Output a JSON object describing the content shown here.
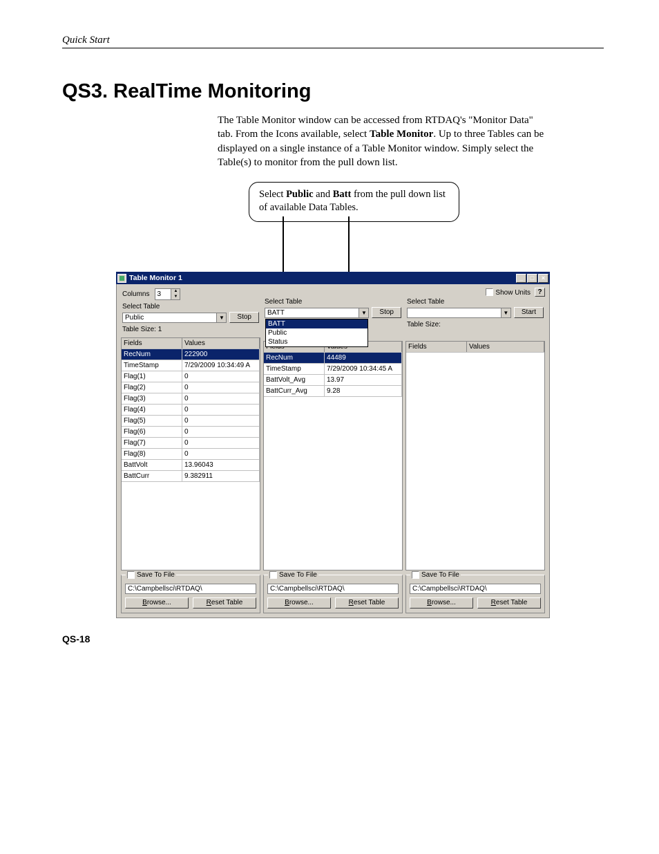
{
  "doc": {
    "running_head": "Quick Start",
    "page_num": "QS-18",
    "section_title": "QS3.  RealTime Monitoring",
    "para_before_bold1": "The Table Monitor window can be accessed from RTDAQ's \"Monitor Data\" tab. From the Icons available, select ",
    "bold1": "Table Monitor",
    "para_after_bold1": ".  Up to three Tables can be displayed on a single instance of a Table Monitor window. Simply select the Table(s) to monitor from the pull down list.",
    "callout_pre": "Select ",
    "callout_b1": "Public",
    "callout_mid": " and ",
    "callout_b2": "Batt",
    "callout_post": " from the pull down list of available Data Tables."
  },
  "win": {
    "title": "Table Monitor 1",
    "show_units_label": "Show Units",
    "help_label": "?",
    "columns_label": "Columns",
    "columns_value": "3",
    "select_table_label": "Select Table",
    "table_size_label_1": "Table Size: 1",
    "table_size_label_3": "Table Size:",
    "stop_label": "Stop",
    "start_label": "Start",
    "fields_header": "Fields",
    "values_header": "Values",
    "save_to_file_label": "Save To File",
    "path_value": "C:\\Campbellsci\\RTDAQ\\",
    "browse_label_char": "B",
    "browse_label_rest": "rowse...",
    "reset_label_char": "R",
    "reset_label_rest": "eset Table",
    "pane1": {
      "selected": "Public",
      "rows": [
        {
          "f": "RecNum",
          "v": "222900",
          "hl": true
        },
        {
          "f": "TimeStamp",
          "v": "7/29/2009 10:34:49 A"
        },
        {
          "f": "Flag(1)",
          "v": "0"
        },
        {
          "f": "Flag(2)",
          "v": "0"
        },
        {
          "f": "Flag(3)",
          "v": "0"
        },
        {
          "f": "Flag(4)",
          "v": "0"
        },
        {
          "f": "Flag(5)",
          "v": "0"
        },
        {
          "f": "Flag(6)",
          "v": "0"
        },
        {
          "f": "Flag(7)",
          "v": "0"
        },
        {
          "f": "Flag(8)",
          "v": "0"
        },
        {
          "f": "BattVolt",
          "v": "13.96043"
        },
        {
          "f": "BattCurr",
          "v": "9.382911"
        }
      ]
    },
    "pane2": {
      "selected": "BATT",
      "options": [
        "BATT",
        "Public",
        "Status"
      ],
      "rows": [
        {
          "f": "RecNum",
          "v": "44489",
          "hl": true
        },
        {
          "f": "TimeStamp",
          "v": "7/29/2009 10:34:45 A"
        },
        {
          "f": "BattVolt_Avg",
          "v": "13.97"
        },
        {
          "f": "BattCurr_Avg",
          "v": "9.28"
        }
      ]
    },
    "pane3": {
      "selected": ""
    }
  }
}
